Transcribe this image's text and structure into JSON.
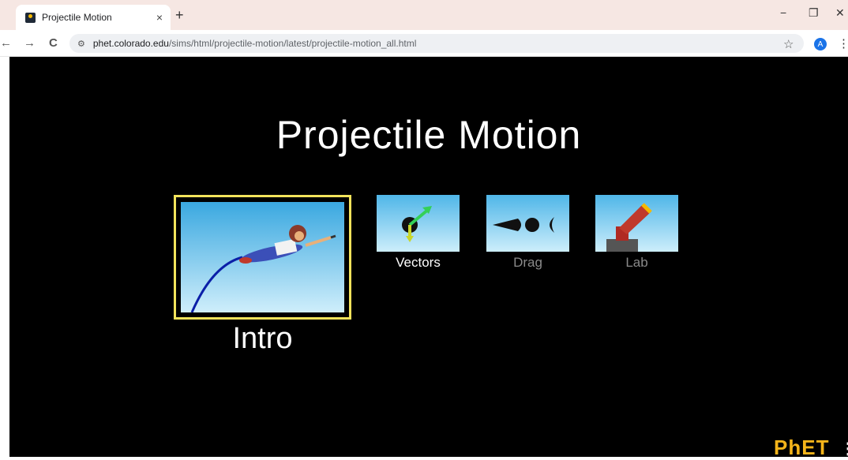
{
  "browser": {
    "tab_title": "Projectile Motion",
    "tab_close": "×",
    "new_tab": "+",
    "minimize": "−",
    "restore": "❐",
    "close": "✕",
    "back": "←",
    "forward": "→",
    "reload": "C",
    "url_host": "phet.colorado.edu",
    "url_path": "/sims/html/projectile-motion/latest/projectile-motion_all.html",
    "bookmark": "☆",
    "profile_initial": "A",
    "menu": "⋮"
  },
  "sim": {
    "title": "Projectile Motion",
    "screens": [
      {
        "label": "Intro",
        "selected": true
      },
      {
        "label": "Vectors",
        "selected": false
      },
      {
        "label": "Drag",
        "selected": false
      },
      {
        "label": "Lab",
        "selected": false
      }
    ],
    "logo": "PhET",
    "menu": "⋮"
  },
  "colors": {
    "background": "#000000",
    "selected_border": "#f2e35b",
    "label_active": "#ffffff",
    "label_inactive": "#8a8a8a"
  }
}
